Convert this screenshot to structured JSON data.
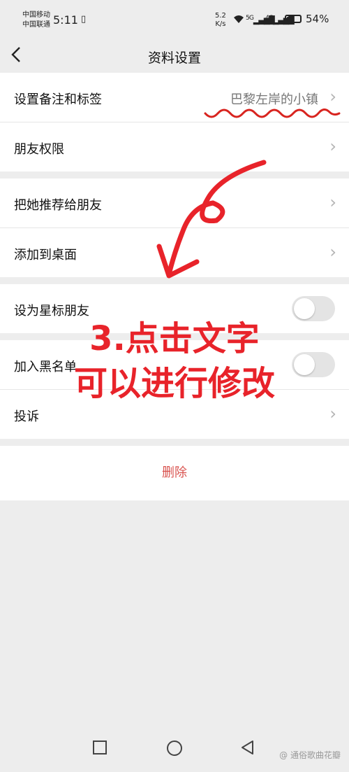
{
  "status_bar": {
    "carrier1": "中国移动",
    "carrier2": "中国联通",
    "time": "5:11",
    "net_speed": "5.2",
    "net_unit": "K/s",
    "sig1": "5G",
    "sig2": "4G",
    "battery_level": 0.54,
    "battery": "54%"
  },
  "header": {
    "title": "资料设置"
  },
  "groups": {
    "g1": [
      {
        "label": "设置备注和标签",
        "value": "巴黎左岸的小镇"
      },
      {
        "label": "朋友权限"
      }
    ],
    "g2": [
      {
        "label": "把她推荐给朋友"
      },
      {
        "label": "添加到桌面"
      }
    ],
    "g3": [
      {
        "label": "设为星标朋友"
      }
    ],
    "g4": [
      {
        "label": "加入黑名单"
      },
      {
        "label": "投诉"
      }
    ]
  },
  "delete_label": "删除",
  "annotation": {
    "line1": "3.点击文字",
    "line2": "可以进行修改"
  },
  "watermark": "@ 通俗歌曲花瓣",
  "colors": {
    "annotation": "#e8232a",
    "delete": "#d9534f"
  }
}
